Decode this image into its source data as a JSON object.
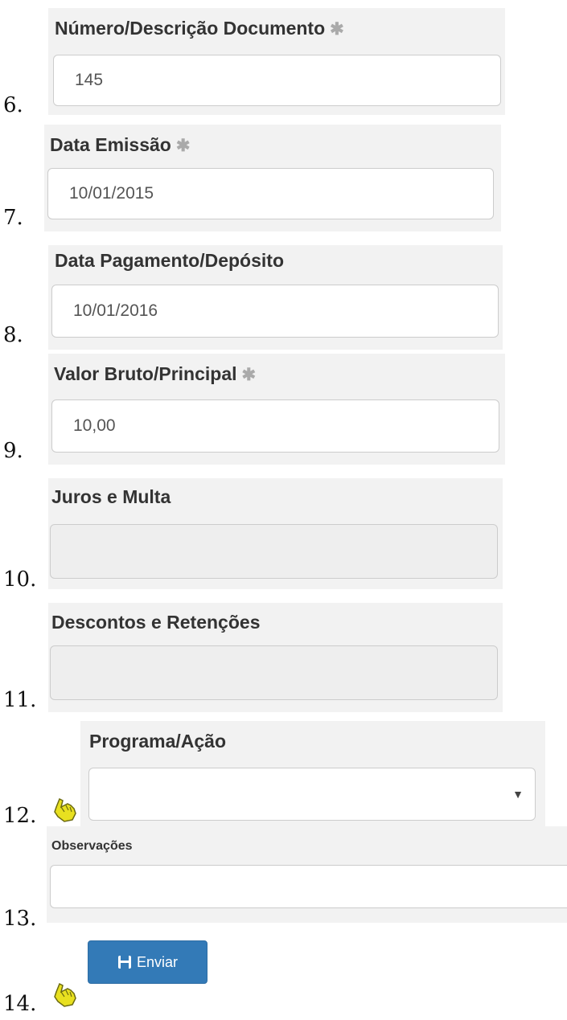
{
  "fields": [
    {
      "number": "6.",
      "label": "Número/Descrição Documento",
      "value": "145",
      "required": true
    },
    {
      "number": "7.",
      "label": "Data Emissão",
      "value": "10/01/2015",
      "required": true
    },
    {
      "number": "8.",
      "label": "Data Pagamento/Depósito",
      "value": "10/01/2016",
      "required": false
    },
    {
      "number": "9.",
      "label": "Valor Bruto/Principal",
      "value": "10,00",
      "required": true
    },
    {
      "number": "10.",
      "label": "Juros e Multa",
      "value": "",
      "required": false,
      "disabled": true
    },
    {
      "number": "11.",
      "label": "Descontos e Retenções",
      "value": "",
      "required": false,
      "disabled": true
    },
    {
      "number": "12.",
      "label": "Programa/Ação",
      "value": "",
      "type": "select"
    },
    {
      "number": "13.",
      "label": "Observações",
      "value": ""
    }
  ],
  "submit": {
    "number": "14.",
    "label": "Enviar"
  },
  "required_mark": "✱",
  "colors": {
    "button": "#337ab7",
    "required_mark": "#aaaaaa",
    "panel": "#f2f2f2"
  },
  "icons": {
    "hand": "pointing-hand-icon",
    "save": "floppy-disk-icon",
    "caret": "caret-down-icon"
  }
}
